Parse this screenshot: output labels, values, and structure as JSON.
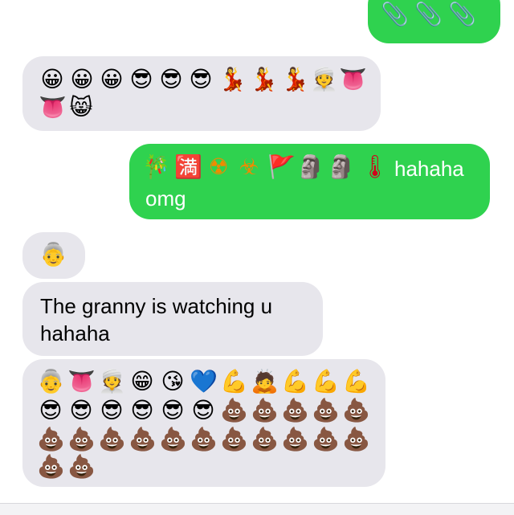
{
  "colors": {
    "sent": "#2fd24f",
    "received": "#e7e6ec"
  },
  "messages": [
    {
      "id": "m1",
      "sender": "me",
      "emoji": [
        "📎",
        "📎",
        "📎"
      ]
    },
    {
      "id": "m2",
      "sender": "them",
      "emoji": [
        "😀",
        "😀",
        "😀",
        "😎",
        "😎",
        "😎",
        "💃",
        "💃",
        "💃",
        "👳",
        "👅",
        "👅",
        "😸"
      ]
    },
    {
      "id": "m3",
      "sender": "me",
      "emoji": [
        "🎋",
        "🈵",
        "☢",
        "☣",
        "🚩",
        "🗿",
        "🗿",
        "🌡"
      ],
      "text_inline": "hahaha",
      "text_line2": "omg"
    },
    {
      "id": "m4",
      "sender": "them",
      "emoji": [
        "👵"
      ]
    },
    {
      "id": "m5",
      "sender": "them",
      "text_line1": "The granny is watching u",
      "text_line2": "hahaha"
    },
    {
      "id": "m6",
      "sender": "them",
      "emoji": [
        "👵",
        "👅",
        "👳",
        "😁",
        "😘",
        "💙",
        "💪",
        "🙇",
        "💪",
        "💪",
        "💪",
        "😎",
        "😎",
        "😎",
        "😎",
        "😎",
        "😎",
        "💩",
        "💩",
        "💩",
        "💩",
        "💩",
        "💩",
        "💩",
        "💩",
        "💩",
        "💩",
        "💩",
        "💩",
        "💩",
        "💩",
        "💩",
        "💩",
        "💩",
        "💩"
      ]
    }
  ]
}
